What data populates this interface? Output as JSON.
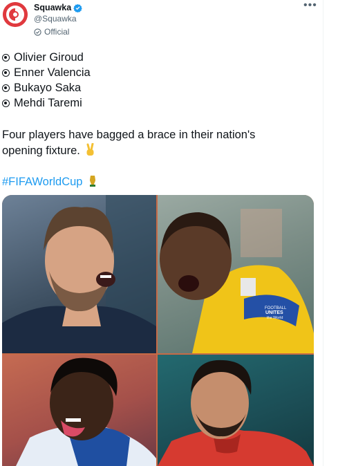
{
  "account": {
    "name": "Squawka",
    "handle": "@Squawka",
    "label": "Official"
  },
  "tweet": {
    "players": [
      "Olivier Giroud",
      "Enner Valencia",
      "Bukayo Saka",
      "Mehdi Taremi"
    ],
    "text_line1": "Four players have bagged a brace in their nation's",
    "text_line2": "opening fixture.",
    "hashtag": "#FIFAWorldCup"
  },
  "media": {
    "armband_text_1": "FOOTBALL",
    "armband_text_2": "UNITES",
    "armband_text_3": "the World"
  },
  "icons": {
    "more": "more-horizontal-icon",
    "verified": "verified-badge-icon",
    "official": "official-label-icon",
    "victory": "victory-hand-emoji",
    "trophy": "world-cup-trophy-emoji"
  },
  "colors": {
    "brand": "#e0393e",
    "link": "#1d9bf0",
    "muted": "#536471"
  }
}
